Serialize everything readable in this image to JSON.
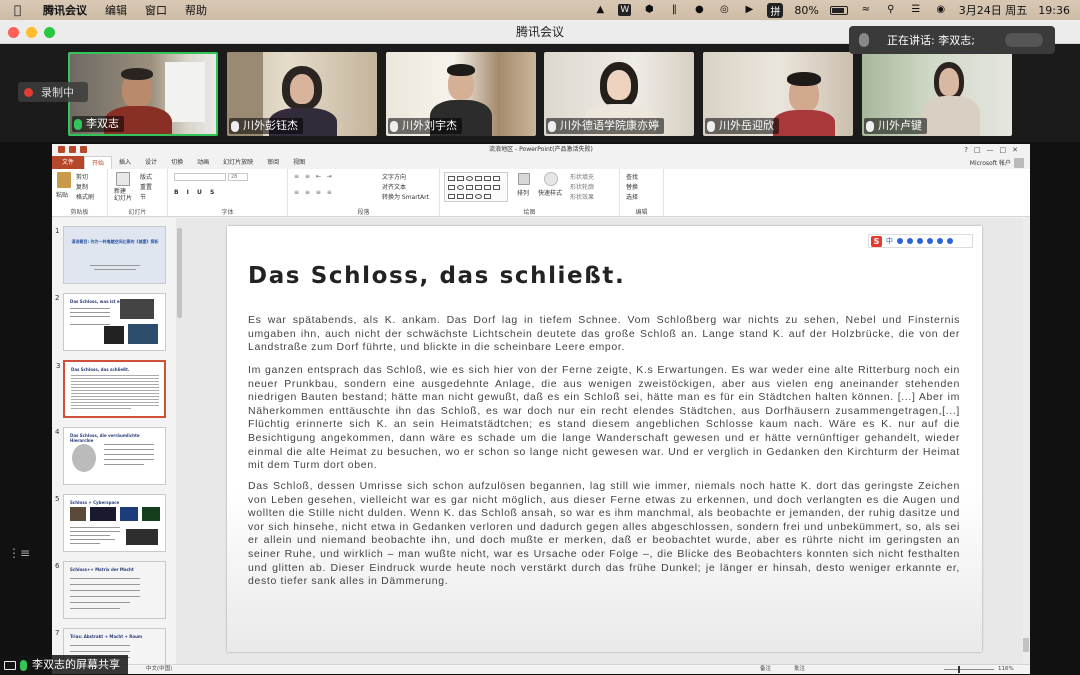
{
  "menubar": {
    "app": "腾讯会议",
    "items": [
      "编辑",
      "窗口",
      "帮助"
    ],
    "ime": "拼",
    "battery": "80%",
    "date": "3月24日 周五",
    "time": "19:36"
  },
  "window": {
    "title": "腾讯会议",
    "speaking": "正在讲话: 李双志;",
    "recording": "录制中"
  },
  "participants": [
    {
      "name": "李双志"
    },
    {
      "name": "川外彭钰杰"
    },
    {
      "name": "川外刘宇杰"
    },
    {
      "name": "川外德语学院康亦婷"
    },
    {
      "name": "川外岳迎欣"
    },
    {
      "name": "川外卢键"
    }
  ],
  "ppt": {
    "title": "流浪地区 - PowerPoint(产品激活失败)",
    "tabs": [
      "文件",
      "开始",
      "插入",
      "设计",
      "切换",
      "动画",
      "幻灯片放映",
      "审阅",
      "视图"
    ],
    "account": "Microsoft 帐户",
    "ribbon": {
      "paste": "粘贴",
      "cut": "剪切",
      "copy": "复制",
      "format_painter": "格式刷",
      "new_slide": "新建\n幻灯片",
      "layout": "版式",
      "reset": "重置",
      "section": "节",
      "font_size": "28",
      "text_direction": "文字方向",
      "align_text": "对齐文本",
      "smartart": "转换为 SmartArt",
      "arrange": "排列",
      "quick_styles": "快速样式",
      "shape_fill": "形状填充",
      "shape_outline": "形状轮廓",
      "shape_effects": "形状效果",
      "find": "查找",
      "replace": "替换",
      "select": "选择",
      "groups": [
        "剪贴板",
        "幻灯片",
        "字体",
        "段落",
        "绘图",
        "编辑"
      ]
    },
    "thumbnails": [
      {
        "num": "1",
        "title": "演讲题目: 作为一种鬼魅空间幻景的《城堡》探析"
      },
      {
        "num": "2",
        "title": "Das Schloss, was ist es?"
      },
      {
        "num": "3",
        "title": "Das Schloss, das schließt."
      },
      {
        "num": "4",
        "title": "Das Schloss, die verräumlichte Hierarchie"
      },
      {
        "num": "5",
        "title": "Schloss + Cyberspace"
      },
      {
        "num": "6",
        "title": "Schloss++ Matrix der Macht"
      },
      {
        "num": "7",
        "title": "Trias: Abstrakt + Macht + Raum"
      }
    ],
    "slide": {
      "heading": "Das Schloss, das schließt.",
      "paragraphs": [
        "Es war spätabends, als K. ankam. Das Dorf lag in tiefem Schnee. Vom Schloßberg war nichts zu sehen, Nebel und Finsternis umgaben ihn, auch nicht der schwächste Lichtschein deutete das große Schloß an. Lange stand K. auf der Holzbrücke, die von der Landstraße zum Dorf führte, und blickte in die scheinbare Leere empor.",
        "Im ganzen entsprach das Schloß, wie es sich hier von der Ferne zeigte, K.s Erwartungen. Es war weder eine alte Ritterburg noch ein neuer Prunkbau, sondern eine ausgedehnte Anlage, die aus wenigen zweistöckigen, aber aus vielen eng aneinander stehenden niedrigen Bauten bestand; hätte man nicht gewußt, daß es ein Schloß sei, hätte man es für ein Städtchen halten können. [...] Aber im Näherkommen enttäuschte ihn das Schloß, es war doch nur ein recht elendes Städtchen, aus Dorfhäusern zusammengetragen,[...] Flüchtig erinnerte sich K. an sein Heimatstädtchen; es stand diesem angeblichen Schlosse kaum nach. Wäre es K. nur auf die Besichtigung angekommen, dann wäre es schade um die lange Wanderschaft gewesen und er hätte vernünftiger gehandelt, wieder einmal die alte Heimat zu besuchen, wo er schon so lange nicht gewesen war. Und er verglich in Gedanken den Kirchturm der Heimat mit dem Turm dort oben.",
        "Das Schloß, dessen Umrisse sich schon aufzulösen begannen, lag still wie immer, niemals noch hatte K. dort das geringste Zeichen von Leben gesehen, vielleicht war es gar nicht möglich, aus dieser Ferne etwas zu erkennen, und doch verlangten es die Augen und wollten die Stille nicht dulden. Wenn K. das Schloß ansah, so war es ihm manchmal, als beobachte er jemanden, der ruhig dasitze und vor sich hinsehe, nicht etwa in Gedanken verloren und dadurch gegen alles abgeschlossen, sondern frei und unbekümmert, so, als sei er allein und niemand beobachte ihn, und doch mußte er merken, daß er beobachtet wurde, aber es rührte nicht im geringsten an seiner Ruhe, und wirklich – man wußte nicht, war es Ursache oder Folge –, die Blicke des Beobachters konnten sich nicht festhalten und glitten ab. Dieser Eindruck wurde heute noch verstärkt durch das frühe Dunkel; je länger er hinsah, desto weniger erkannte er, desto tiefer sank alles in Dämmerung."
      ],
      "ime_mode": "中"
    },
    "status": {
      "language": "中文(中国)",
      "notes": "备注",
      "comments": "批注",
      "zoom": "116%"
    }
  },
  "share_label": "李双志的屏幕共享"
}
